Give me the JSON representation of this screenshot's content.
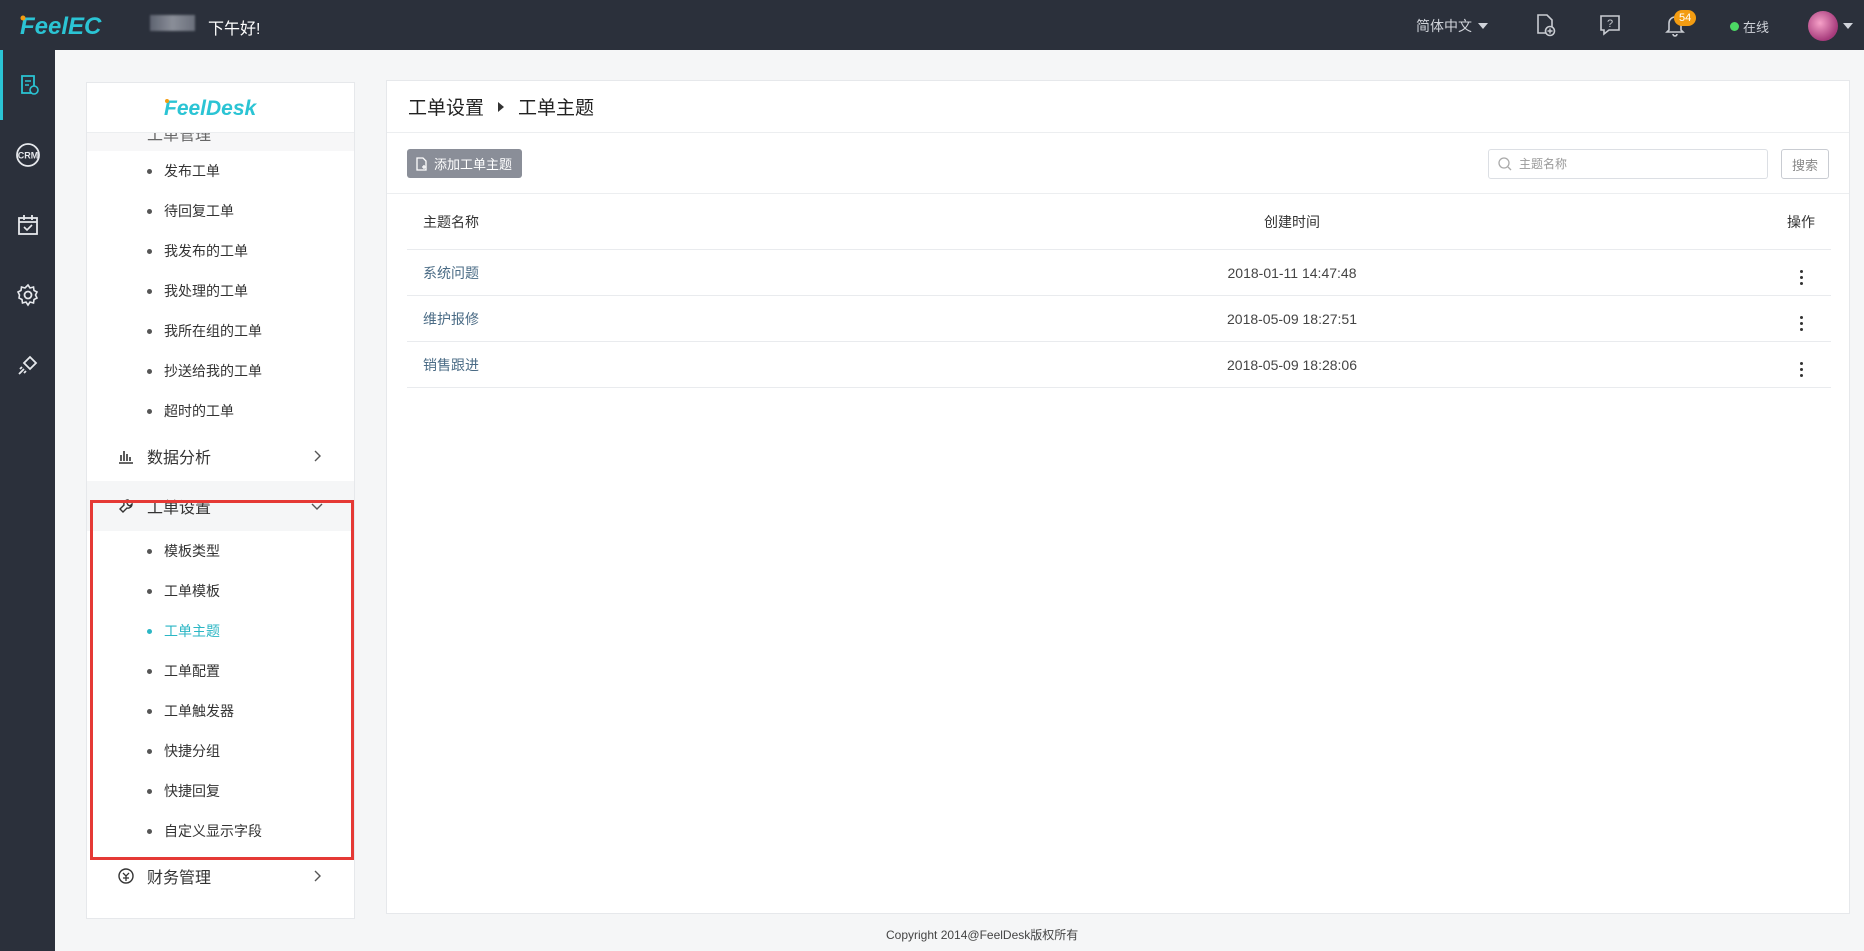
{
  "topbar": {
    "brand": "FeelEC",
    "greeting": "下午好!",
    "language": "简体中文",
    "notification_count": "54",
    "status": "在线"
  },
  "rail": {
    "items": [
      {
        "name": "ticket-icon",
        "active": true
      },
      {
        "name": "crm-icon",
        "label": "CRM"
      },
      {
        "name": "calendar-icon"
      },
      {
        "name": "settings-icon"
      },
      {
        "name": "plugin-icon"
      }
    ]
  },
  "menu": {
    "brand": "FeelDesk",
    "cut_group": "工单管理",
    "ticket_items": [
      "发布工单",
      "待回复工单",
      "我发布的工单",
      "我处理的工单",
      "我所在组的工单",
      "抄送给我的工单",
      "超时的工单"
    ],
    "analytics": "数据分析",
    "settings_group": "工单设置",
    "settings_items": [
      "模板类型",
      "工单模板",
      "工单主题",
      "工单配置",
      "工单触发器",
      "快捷分组",
      "快捷回复",
      "自定义显示字段"
    ],
    "active_item": "工单主题",
    "finance": "财务管理"
  },
  "breadcrumb": {
    "parent": "工单设置",
    "current": "工单主题"
  },
  "toolbar": {
    "add_label": "添加工单主题",
    "search_placeholder": "主题名称",
    "search_label": "搜索"
  },
  "table": {
    "headers": [
      "主题名称",
      "创建时间",
      "操作"
    ],
    "rows": [
      {
        "name": "系统问题",
        "created": "2018-01-11 14:47:48"
      },
      {
        "name": "维护报修",
        "created": "2018-05-09 18:27:51"
      },
      {
        "name": "销售跟进",
        "created": "2018-05-09 18:28:06"
      }
    ]
  },
  "footer": "Copyright 2014@FeelDesk版权所有",
  "colors": {
    "accent": "#2bc4d4",
    "topbar": "#2b303b",
    "highlight_box": "#e53935"
  }
}
